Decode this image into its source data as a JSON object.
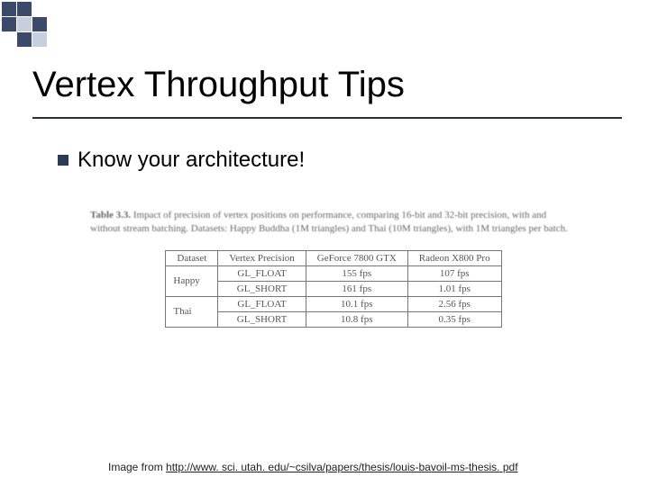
{
  "title": "Vertex Throughput Tips",
  "bullet": "Know your architecture!",
  "caption_prefix": "Table 3.3.",
  "caption_body": " Impact of precision of vertex positions on performance, comparing 16-bit and 32-bit precision, with and without stream batching. Datasets: Happy Buddha (1M triangles) and Thai (10M triangles), with 1M triangles per batch.",
  "chart_data": {
    "type": "table",
    "title": "Table 3.3",
    "columns": [
      "Dataset",
      "Vertex Precision",
      "GeForce 7800 GTX",
      "Radeon X800 Pro"
    ],
    "rows": [
      {
        "dataset": "Happy",
        "precision": "GL_FLOAT",
        "nv": "155 fps",
        "ati": "107 fps"
      },
      {
        "dataset": "",
        "precision": "GL_SHORT",
        "nv": "161 fps",
        "ati": "1.01 fps"
      },
      {
        "dataset": "Thai",
        "precision": "GL_FLOAT",
        "nv": "10.1 fps",
        "ati": "2.56 fps"
      },
      {
        "dataset": "",
        "precision": "GL_SHORT",
        "nv": "10.8 fps",
        "ati": "0.35 fps"
      }
    ]
  },
  "credit_prefix": "Image from ",
  "credit_url": "http://www. sci. utah. edu/~csilva/papers/thesis/louis-bavoil-ms-thesis. pdf"
}
